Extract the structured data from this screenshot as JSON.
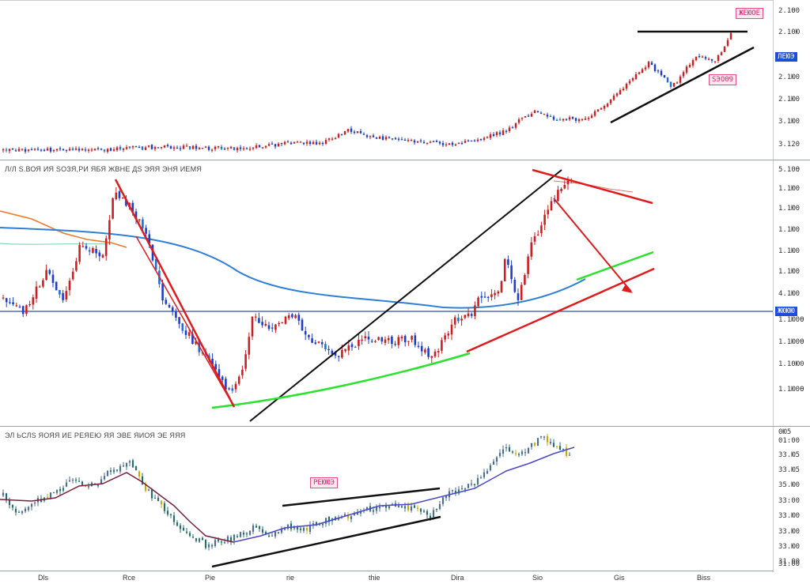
{
  "colors": {
    "up": "#1d3fc8",
    "down": "#cc1f1f",
    "mid": "#1f6fd6",
    "green": "#29e22d",
    "red_line": "#e01b1b",
    "black": "#111111",
    "blue_ma": "#2f7fd6",
    "orange": "#f07a28",
    "purple": "#4a48c9"
  },
  "top_pane": {
    "ticks": [
      "2.1Ѳ0",
      "2.10Ю",
      "2.1Ю0",
      "2.1Ю0",
      "3.1Ю0",
      "3.120"
    ],
    "tag_top": "ЖЕЮОЕ",
    "tag_mid": "SЭО09",
    "price_badge": "ЛЕЮЭ"
  },
  "mid_pane": {
    "header": "Л/Л Ѕ.ВОЯ ИЯ ЅОЗЯ,РИ ЯБЯ ЖВНЕ ДЅ ЭЯЯ ЭНЯ ИЕМЯ",
    "ticks": [
      "5.10Ѳ",
      "1.1Ю0",
      "1.1Ю0",
      "1.1Ю0",
      "1.1Ю0",
      "1.1Ю0",
      "4.1Ю0",
      "1.1Ю0Ѳ",
      "1.1Ю0Ѳ",
      "1.10Ю0",
      "1.1Ю0Ѳ"
    ],
    "price_badge": "ЖЮЮЮ"
  },
  "bot_pane": {
    "header": "ЭЛ ЬСЛЅ ЯОЯЯ ИЕ РЕЯЕЮ ЯЯ ЭВЕ ЯИОЯ ЭЕ ЯЯЯ",
    "tag": "РЕЮЮЭ",
    "ticks": [
      "0Ю5",
      "01:00",
      "33.Ю5",
      "33.Ю5",
      "35.Ю0",
      "33:00",
      "33.Ю0",
      "33.Ю0",
      "33.Ю0",
      "31.00",
      "31.00"
    ]
  },
  "x_labels": [
    "Dls",
    "Rce",
    "Pie",
    "rie",
    "thie",
    "Dira",
    "Sio",
    "Gis",
    "Biss"
  ],
  "chart_data": [
    {
      "type": "line",
      "x": [],
      "series": [],
      "title": "",
      "xlabel": "",
      "ylabel": "",
      "grid": false
    },
    {
      "type": "line",
      "x": [],
      "series": [],
      "title": "",
      "xlabel": "",
      "ylabel": "",
      "grid": false
    },
    {
      "type": "line",
      "x": [],
      "series": [],
      "title": "",
      "xlabel": "",
      "ylabel": "",
      "grid": false
    }
  ]
}
